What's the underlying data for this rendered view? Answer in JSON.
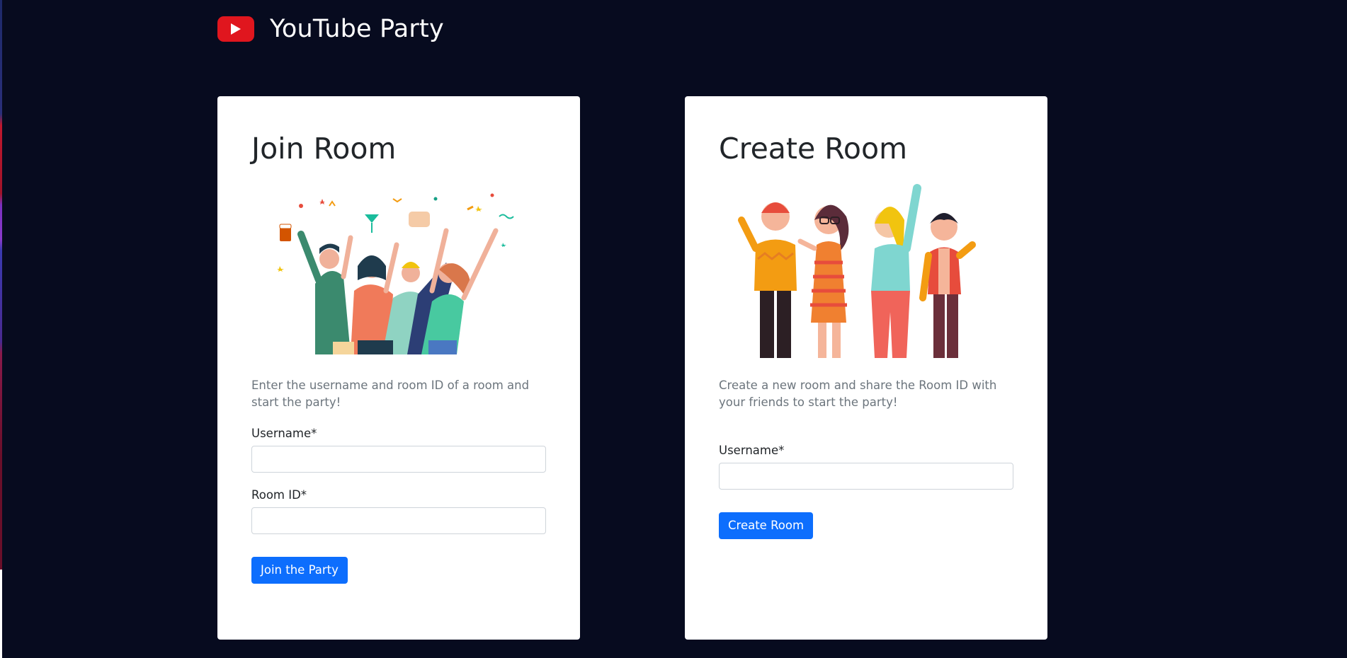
{
  "app": {
    "title": "YouTube Party",
    "logo_icon": "youtube-play-icon",
    "brand_color": "#e0161e"
  },
  "join": {
    "title": "Join Room",
    "description": "Enter the username and room ID of a room and start the party!",
    "username_label": "Username*",
    "room_id_label": "Room ID*",
    "username_value": "",
    "room_id_value": "",
    "button_label": "Join the Party"
  },
  "create": {
    "title": "Create Room",
    "description": "Create a new room and share the Room ID with your friends to start the party!",
    "username_label": "Username*",
    "username_value": "",
    "button_label": "Create Room"
  },
  "colors": {
    "background": "#070b1f",
    "card": "#ffffff",
    "primary": "#0d6efd",
    "muted": "#6c757d"
  }
}
